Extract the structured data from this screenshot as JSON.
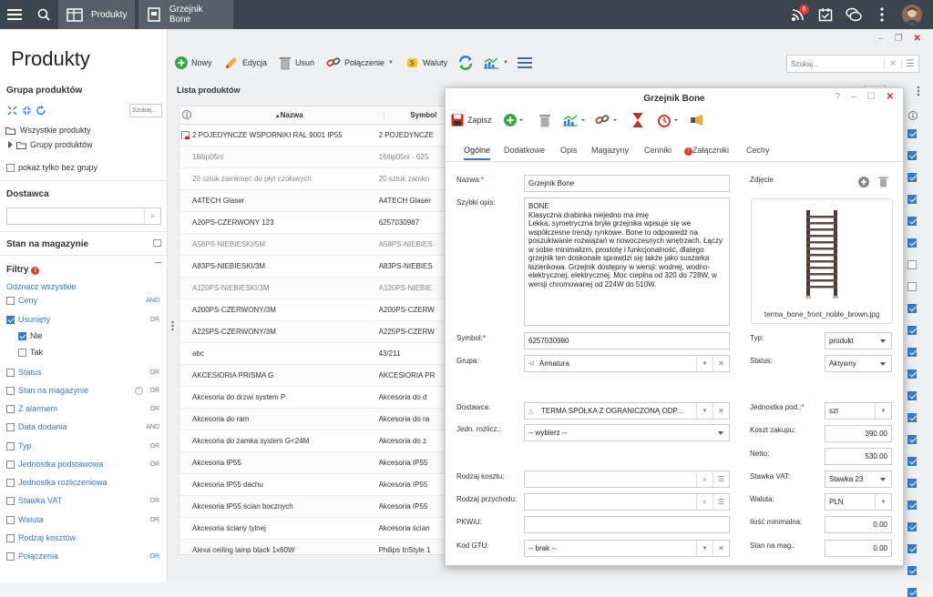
{
  "topbar": {
    "tab1": "Produkty",
    "tab2": "Grzejnik Bone",
    "badge": "6"
  },
  "sidebar": {
    "title": "Produkty",
    "group_header": "Grupa produktów",
    "search_placeholder": "Szukaj...",
    "tree_all": "Wszystkie produkty",
    "tree_groups": "Grupy produktów",
    "only_no_group": "pokaż tylko bez grupy",
    "supplier_header": "Dostawca",
    "stock_header": "Stan na magazynie",
    "filters_header": "Filtry",
    "uncheck_all": "Odznacz wszystkie",
    "filters": [
      {
        "label": "Ceny",
        "tag": "AND"
      },
      {
        "label": "Usunięty",
        "tag": "OR"
      },
      {
        "label": "Nie",
        "tag": ""
      },
      {
        "label": "Tak",
        "tag": ""
      },
      {
        "label": "Status",
        "tag": "OR"
      },
      {
        "label": "Stan na magazynie",
        "tag": "OR"
      },
      {
        "label": "Z alarmem",
        "tag": "OR"
      },
      {
        "label": "Data dodania",
        "tag": "AND"
      },
      {
        "label": "Typ",
        "tag": "OR"
      },
      {
        "label": "Jednostka podstawowa",
        "tag": "OR"
      },
      {
        "label": "Jednostka rozliczeniowa",
        "tag": ""
      },
      {
        "label": "Stawka VAT",
        "tag": "OR"
      },
      {
        "label": "Waluta",
        "tag": "OR"
      },
      {
        "label": "Rodzaj kosztów",
        "tag": ""
      },
      {
        "label": "Połączenia",
        "tag": "OR"
      }
    ]
  },
  "toolbar": {
    "new": "Nowy",
    "edit": "Edycja",
    "delete": "Usuń",
    "connect": "Połączenie",
    "currency": "Waluty",
    "search_placeholder": "Szukaj..."
  },
  "list": {
    "title": "Lista produktów",
    "col_name": "Nazwa",
    "col_symbol": "Symbol",
    "rows": [
      {
        "name": "2 POJEDYNCZE WSPORNIKI RAL 9001 IP55",
        "symbol": "2 POJEDYNCZE"
      },
      {
        "name": "16itip05ni",
        "symbol": "16itip05ni - 625"
      },
      {
        "name": "20 sztuk zamknięć do płyt czołowych",
        "symbol": "20 sztuk zamkn"
      },
      {
        "name": "A4TECH Glaser",
        "symbol": "A4TECH Glaser"
      },
      {
        "name": "A20PS-CZERWONY 123",
        "symbol": "6257030987"
      },
      {
        "name": "A58PS-NIEBIESKI/5M",
        "symbol": "A58PS-NIEBIES"
      },
      {
        "name": "A83PS-NIEBIESKI/3M",
        "symbol": "A83PS-NIEBIES"
      },
      {
        "name": "A120PS-NIEBIESKI/3M",
        "symbol": "A120PS-NIEBIE"
      },
      {
        "name": "A200PS-CZERWONY/3M",
        "symbol": "A200PS-CZERW"
      },
      {
        "name": "A225PS-CZERWONY/3M",
        "symbol": "A225PS-CZERW"
      },
      {
        "name": "abc",
        "symbol": "43/211"
      },
      {
        "name": "AKCESIORIA PRISMA G",
        "symbol": "AKCESIORIA PR"
      },
      {
        "name": "Akcesoria do drzwi system P",
        "symbol": "Akcesoria do d"
      },
      {
        "name": "Akcesoria do ram",
        "symbol": "Akcesoria do ra"
      },
      {
        "name": "Akcesoria do zamka system G<24M",
        "symbol": "Akcesoria do z"
      },
      {
        "name": "Akcesoria IP55",
        "symbol": "Akcesoria IP55"
      },
      {
        "name": "Akcesoria IP55 dachu",
        "symbol": "Akcesoria IP55"
      },
      {
        "name": "Akcesoria IP55 ścian bocznych",
        "symbol": "Akcesoria IP55"
      },
      {
        "name": "Akcesoria ściany tylnej",
        "symbol": "Akcesoria ścian"
      },
      {
        "name": "Alexa ceiling lamp black 1x60W",
        "symbol": "Philips InStyle 1"
      }
    ]
  },
  "dialog": {
    "title": "Grzejnik Bone",
    "save": "Zapisz",
    "tabs": [
      "Ogólne",
      "Dodatkowe",
      "Opis",
      "Magazyny",
      "Cenniki",
      "Załączniki",
      "Cechy"
    ],
    "labels": {
      "name": "Nazwa:",
      "short_desc": "Szybki opis:",
      "symbol": "Symbol:",
      "group": "Grupa:",
      "supplier": "Dostawca:",
      "unit_settle": "Jedn. rozlicz.:",
      "cost_type": "Rodzaj kosztu:",
      "income_type": "Rodzaj przychodu:",
      "pkwiu": "PKWiU:",
      "gtu": "Kod GTU:",
      "photo": "Zdjęcie",
      "type": "Typ:",
      "status": "Status:",
      "unit": "Jednostka pod.:",
      "purchase_cost": "Koszt zakupu:",
      "net": "Netto:",
      "vat": "Stawka VAT:",
      "currency": "Waluta:",
      "min_qty": "Ilość minimalna:",
      "stock": "Stan na mag.:"
    },
    "values": {
      "name": "Grzejnik Bone",
      "desc_title": "BONE",
      "desc_sub": "Klasyczna drabinka niejedno ma imię",
      "desc_body": "Lekka, symetryczna bryła grzejnika wpisuje się we współczesne trendy rynkowe. Bone to odpowiedź na poszukiwanie rozwiązań w nowoczesnych wnętrzach. Łączy w sobie minimalizm, prostotę i funkcjonalność, dlatego grzejnik ten doskonale sprawdzi się także jako suszarka łazienkowa. Grzejnik dostępny w wersji: wodnej, wodno-elektrycznej, elektrycznej. Moc cieplna od 320 do 728W, w wersji chromowanej od 224W do 510W.",
      "symbol": "6257030980",
      "group": "Armatura",
      "supplier": "TERMA SPÓŁKA Z OGRANICZONĄ ODP...",
      "unit_settle": "-- wybierz --",
      "gtu": "-- brak --",
      "photo_caption": "terma_bone_front_noble_brown.jpg",
      "type": "produkt",
      "status": "Aktywny",
      "unit": "szt",
      "purchase_cost": "390.00",
      "net": "530.00",
      "vat": "Stawka 23",
      "currency": "PLN",
      "min_qty": "0.00",
      "stock": "0.00"
    }
  },
  "right_checks": [
    true,
    true,
    true,
    true,
    true,
    true,
    false,
    false,
    true,
    true,
    true,
    true,
    true,
    true,
    true,
    true,
    true,
    true,
    true,
    true,
    true,
    true
  ]
}
